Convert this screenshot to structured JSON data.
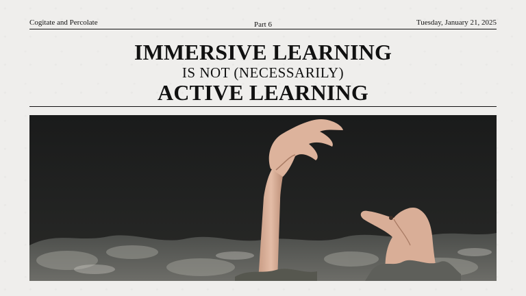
{
  "masthead": {
    "publication": "Cogitate and Percolate",
    "part": "Part 6",
    "date": "Tuesday, January 21, 2025"
  },
  "headline": {
    "line1": "IMMERSIVE LEARNING",
    "line2": "IS NOT (NECESSARILY)",
    "line3": "ACTIVE LEARNING"
  },
  "photo": {
    "subject": "hands-rising-from-dark-water"
  }
}
